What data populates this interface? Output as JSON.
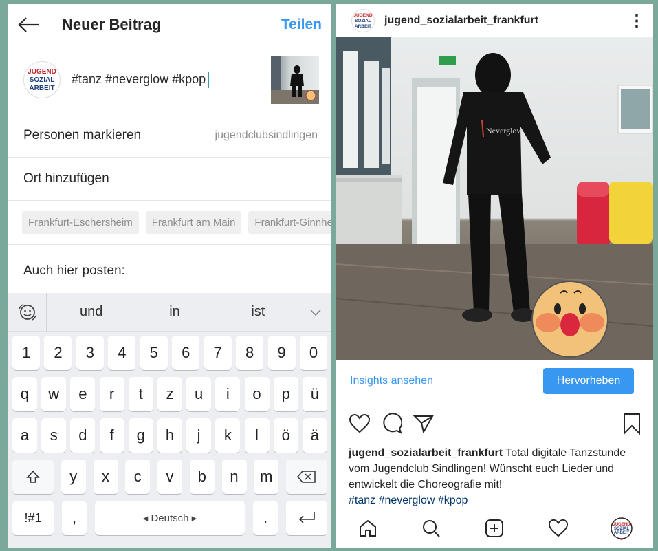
{
  "new_post": {
    "title": "Neuer Beitrag",
    "share": "Teilen",
    "caption": "#tanz #neverglow #kpop",
    "logo_text": [
      "JUGEND",
      "SOZIAL",
      "ARBEIT"
    ],
    "tag_people_label": "Personen markieren",
    "tag_people_value": "jugendclubsindlingen",
    "add_location_label": "Ort hinzufügen",
    "location_chips": [
      "Frankfurt-Eschersheim",
      "Frankfurt am Main",
      "Frankfurt-Ginnheim"
    ],
    "also_post_label": "Auch hier posten:"
  },
  "keyboard": {
    "suggestions": [
      "und",
      "in",
      "ist"
    ],
    "row_numbers": [
      "1",
      "2",
      "3",
      "4",
      "5",
      "6",
      "7",
      "8",
      "9",
      "0"
    ],
    "row_1": [
      "q",
      "w",
      "e",
      "r",
      "t",
      "z",
      "u",
      "i",
      "o",
      "p",
      "ü"
    ],
    "row_2": [
      "a",
      "s",
      "d",
      "f",
      "g",
      "h",
      "j",
      "k",
      "l",
      "ö",
      "ä"
    ],
    "row_3": [
      "y",
      "x",
      "c",
      "v",
      "b",
      "n",
      "m"
    ],
    "symbols": "!#1",
    "comma": ",",
    "space": "◂ Deutsch ▸",
    "period": "."
  },
  "feed_post": {
    "username": "jugend_sozialarbeit_frankfurt",
    "more": "⋮",
    "insights": "Insights ansehen",
    "highlight": "Hervorheben",
    "caption_user": "jugend_sozialarbeit_frankfurt",
    "caption_text": " Total digitale Tanzstunde vom Jugendclub Sindlingen! Wünscht euch Lieder und entwickelt die Choreografie mit!",
    "caption_tags": "#tanz #neverglow #kpop",
    "shirt_text": "Neverglow"
  },
  "colors": {
    "accent": "#3897f0",
    "background": "#7aa89a",
    "exit_sign": "#2f9e4a",
    "bin": "#d7263d",
    "sofa": "#f2d43a"
  }
}
